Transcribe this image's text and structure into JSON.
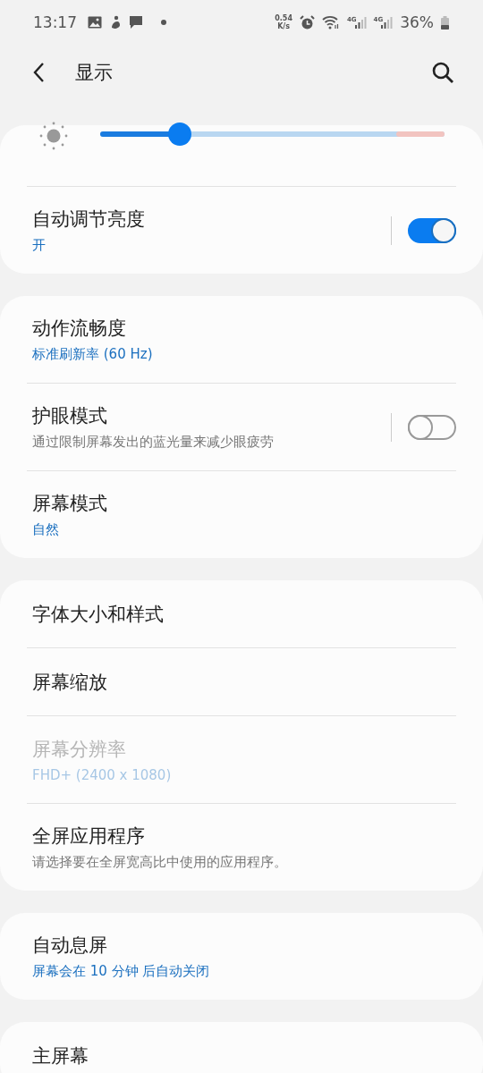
{
  "status_bar": {
    "time": "13:17",
    "net_speed_value": "0.54",
    "net_speed_unit": "K/s",
    "signals": [
      {
        "label": "4G"
      },
      {
        "label": "4G"
      }
    ],
    "battery": "36%"
  },
  "header": {
    "title": "显示"
  },
  "groups": [
    {
      "items": [
        {
          "kind": "slider",
          "level": 0.23
        },
        {
          "kind": "toggle",
          "title": "自动调节亮度",
          "subtitle": {
            "kind": "value",
            "text": "开"
          },
          "on": true,
          "disabled": false
        }
      ]
    },
    {
      "items": [
        {
          "kind": "link",
          "title": "动作流畅度",
          "subtitle": {
            "kind": "value",
            "text": "标准刷新率 (60 Hz)"
          },
          "disabled": false
        },
        {
          "kind": "toggle",
          "title": "护眼模式",
          "subtitle": {
            "kind": "description",
            "text": "通过限制屏幕发出的蓝光量来减少眼疲劳"
          },
          "on": false,
          "disabled": false
        },
        {
          "kind": "link",
          "title": "屏幕模式",
          "subtitle": {
            "kind": "value",
            "text": "自然"
          },
          "disabled": false
        }
      ]
    },
    {
      "items": [
        {
          "kind": "link",
          "title": "字体大小和样式",
          "disabled": false
        },
        {
          "kind": "link",
          "title": "屏幕缩放",
          "disabled": false
        },
        {
          "kind": "link",
          "title": "屏幕分辨率",
          "subtitle": {
            "kind": "value",
            "text": "FHD+ (2400 x 1080)"
          },
          "disabled": true
        },
        {
          "kind": "link",
          "title": "全屏应用程序",
          "subtitle": {
            "kind": "description",
            "text": "请选择要在全屏宽高比中使用的应用程序。"
          },
          "disabled": false
        }
      ]
    },
    {
      "items": [
        {
          "kind": "link",
          "title": "自动息屏",
          "subtitle": {
            "kind": "value",
            "text": "屏幕会在 10 分钟 后自动关闭"
          },
          "disabled": false
        }
      ]
    },
    {
      "items": [
        {
          "kind": "link",
          "title": "主屏幕",
          "disabled": false
        }
      ]
    }
  ]
}
